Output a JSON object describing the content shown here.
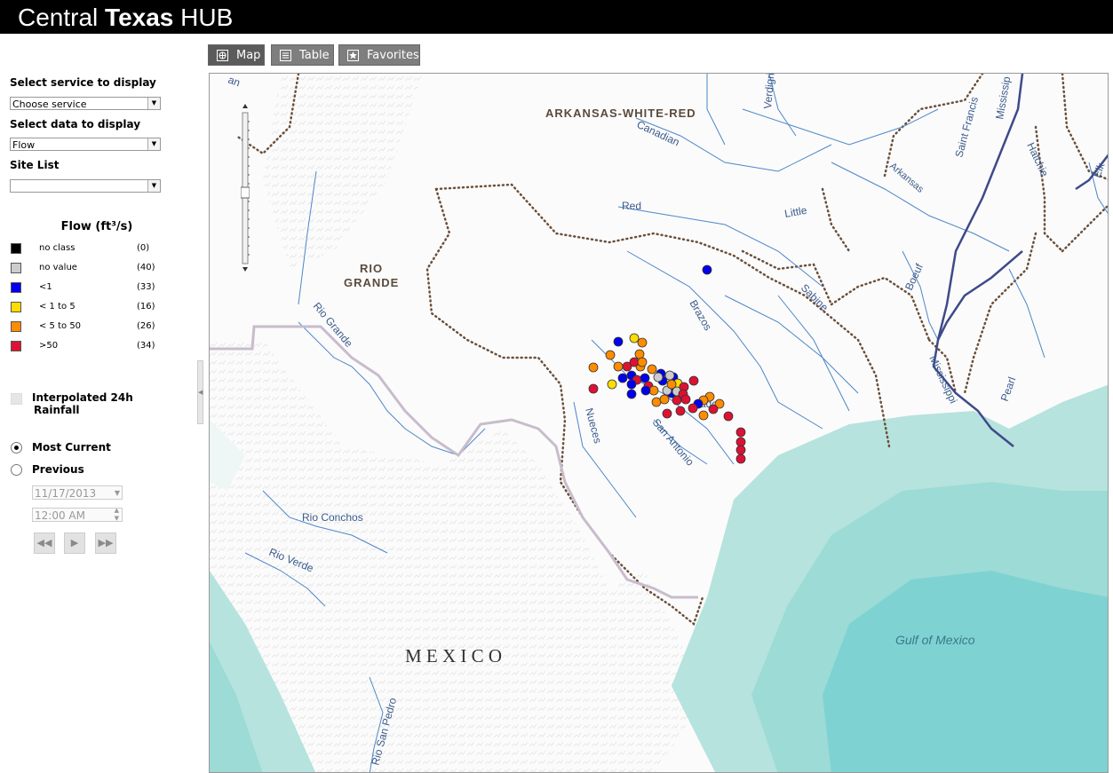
{
  "header": {
    "title_part1": "Central",
    "title_part2": "Texas",
    "title_part3": "HUB"
  },
  "sidebar": {
    "service_label": "Select service to display",
    "service_value": "Choose service",
    "data_label": "Select data to display",
    "data_value": "Flow",
    "site_list_label": "Site List",
    "site_list_value": ""
  },
  "legend": {
    "title": "Flow (ft³/s)",
    "items": [
      {
        "label": "no class",
        "count": "(0)",
        "color": "#000000"
      },
      {
        "label": "no value",
        "count": "(40)",
        "color": "#cccccc"
      },
      {
        "label": "<1",
        "count": "(33)",
        "color": "#0000ee"
      },
      {
        "label": "< 1 to 5",
        "count": "(16)",
        "color": "#ffdd00"
      },
      {
        "label": "< 5 to 50",
        "count": "(26)",
        "color": "#ff8c00"
      },
      {
        "label": ">50",
        "count": "(34)",
        "color": "#dd1133"
      }
    ]
  },
  "rainfall": {
    "label_line1": "Interpolated 24h",
    "label_line2": "Rainfall",
    "checked": false
  },
  "time": {
    "most_current_label": "Most Current",
    "previous_label": "Previous",
    "selected": "most_current",
    "date_value": "11/17/2013",
    "time_value": "12:00 AM"
  },
  "playback": {
    "rewind_icon": "rewind-icon",
    "play_icon": "play-icon",
    "forward_icon": "fast-forward-icon"
  },
  "tabs": [
    {
      "label": "Map",
      "icon": "map-icon",
      "active": true
    },
    {
      "label": "Table",
      "icon": "table-icon",
      "active": false
    },
    {
      "label": "Favorites",
      "icon": "star-icon",
      "active": false
    }
  ],
  "map": {
    "labels": {
      "arkansas": "ARKANSAS-WHITE-RED",
      "rio1": "RIO",
      "rio2": "GRANDE",
      "mexico": "M E X I C O",
      "gulf": "Gulf of Mexico",
      "canadian": "Canadian",
      "red": "Red",
      "little": "Little",
      "brazos": "Brazos",
      "sabine": "Sabine",
      "nueces": "Nueces",
      "sanantonio": "San Antonio",
      "riogrande_river": "Rio Grande",
      "rioconchos": "Rio Conchos",
      "rioverde": "Rio Verde",
      "riosanpedro": "Rio San Pedro",
      "verdigris": "Verdigri",
      "mississippi_top": "Mississip",
      "saintfrancis": "Saint Francis",
      "hatchie": "Hatchie",
      "arkansas_river": "Arkansas",
      "boeuf": "Boeuf",
      "mississippi_bottom": "Mississippi",
      "pearl": "Pearl",
      "elk": "Elk",
      "colorado": "rado",
      "an_fragment": "an"
    },
    "colors": {
      "water": "#b6e3dd",
      "water_deep": "#7fd2d2",
      "border": "#6b4f3a",
      "river": "#4d86c8"
    }
  }
}
